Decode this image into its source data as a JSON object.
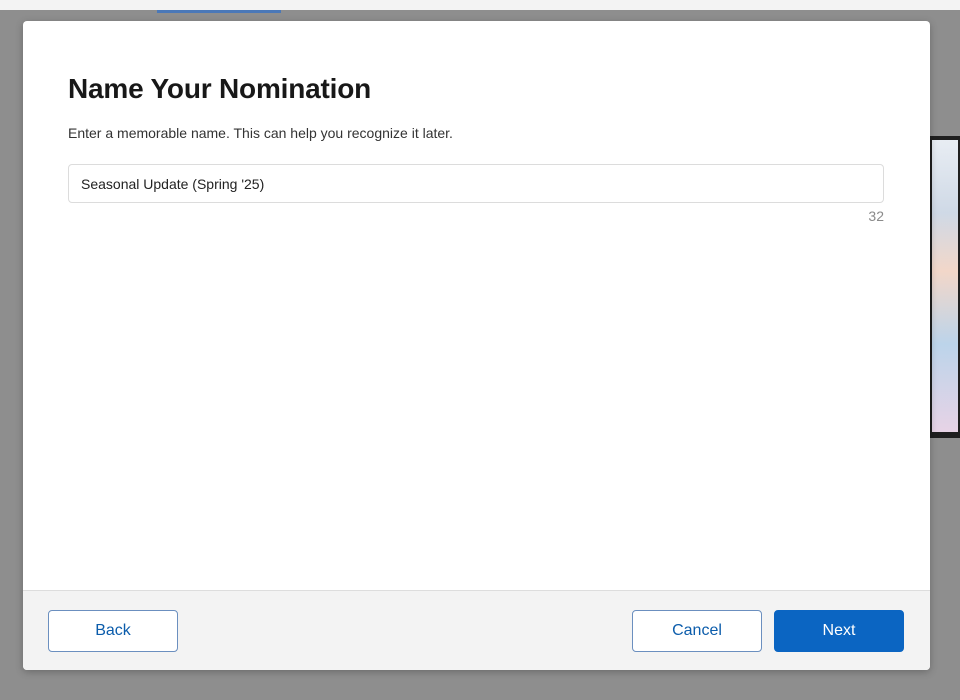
{
  "modal": {
    "title": "Name Your Nomination",
    "subtitle": "Enter a memorable name. This can help you recognize it later.",
    "name_input": {
      "value": "Seasonal Update (Spring '25)",
      "placeholder": ""
    },
    "char_count": "32"
  },
  "footer": {
    "back_label": "Back",
    "cancel_label": "Cancel",
    "next_label": "Next"
  },
  "colors": {
    "brand": "#0b65c2",
    "overlay": "#8e8e8e",
    "footer_bg": "#f3f3f3"
  }
}
